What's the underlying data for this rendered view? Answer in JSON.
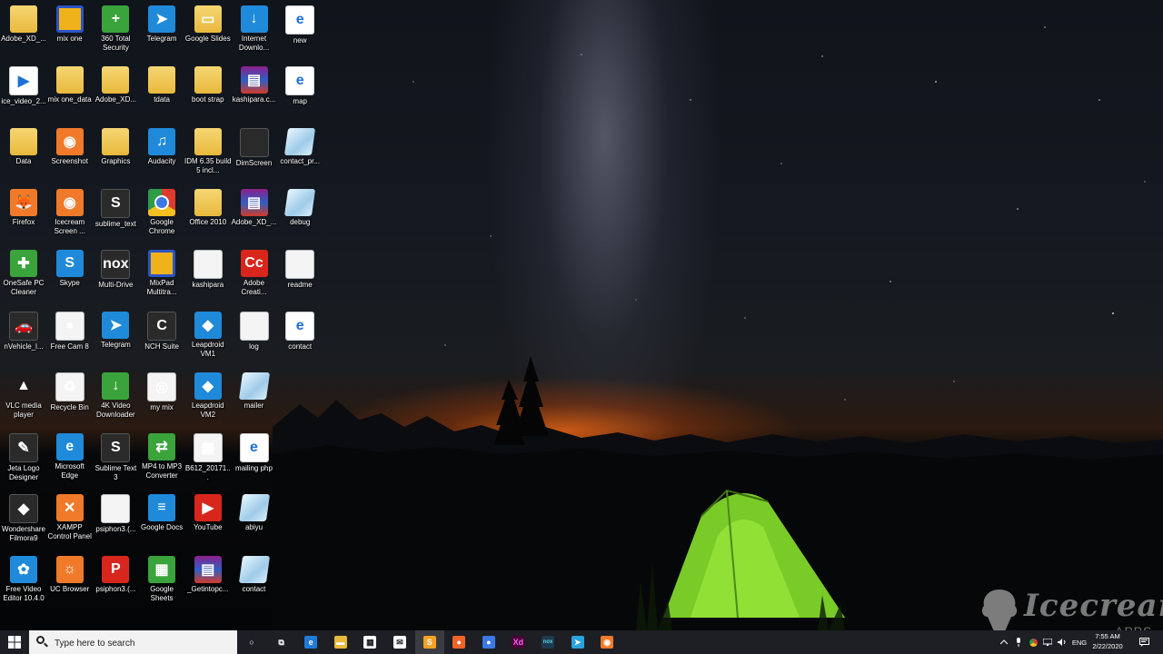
{
  "desktop": {
    "icons": [
      {
        "label": "Adobe_XD_...",
        "icon": "folder-icon"
      },
      {
        "label": "mix one",
        "icon": "mixpad-icon"
      },
      {
        "label": "360 Total Security",
        "icon": "360-security-icon"
      },
      {
        "label": "Telegram",
        "icon": "telegram-icon"
      },
      {
        "label": "Google Slides",
        "icon": "google-slides-icon"
      },
      {
        "label": "Internet Downlo...",
        "icon": "idm-icon"
      },
      {
        "label": "new",
        "icon": "ie-document-icon"
      },
      {
        "label": "ice_video_2...",
        "icon": "video-file-icon"
      },
      {
        "label": "mix one_data",
        "icon": "folder-icon"
      },
      {
        "label": "Adobe_XD...",
        "icon": "folder-icon"
      },
      {
        "label": "tdata",
        "icon": "folder-icon"
      },
      {
        "label": "boot strap",
        "icon": "folder-icon"
      },
      {
        "label": "kashipara.c...",
        "icon": "winrar-icon"
      },
      {
        "label": "map",
        "icon": "ie-document-icon"
      },
      {
        "label": "Data",
        "icon": "folder-icon"
      },
      {
        "label": "Screenshot",
        "icon": "icecream-screenshot-icon"
      },
      {
        "label": "Graphics",
        "icon": "folder-icon"
      },
      {
        "label": "Audacity",
        "icon": "audacity-icon"
      },
      {
        "label": "IDM 6.35 build 5 incl...",
        "icon": "folder-icon"
      },
      {
        "label": "DimScreen",
        "icon": "dimscreen-icon"
      },
      {
        "label": "contact_pr...",
        "icon": "glass-file-icon"
      },
      {
        "label": "Firefox",
        "icon": "firefox-icon"
      },
      {
        "label": "Icecream Screen ...",
        "icon": "icecream-recorder-icon"
      },
      {
        "label": "sublime_text",
        "icon": "sublime-icon"
      },
      {
        "label": "Google Chrome",
        "icon": "chrome-icon"
      },
      {
        "label": "Office 2010",
        "icon": "folder-icon"
      },
      {
        "label": "Adobe_XD_...",
        "icon": "winrar-icon"
      },
      {
        "label": "debug",
        "icon": "glass-file-icon"
      },
      {
        "label": "OneSafe PC Cleaner",
        "icon": "onesafe-icon"
      },
      {
        "label": "Skype",
        "icon": "skype-icon"
      },
      {
        "label": "Multi-Drive",
        "icon": "nox-icon"
      },
      {
        "label": "MixPad Multitra...",
        "icon": "mixpad-icon"
      },
      {
        "label": "kashipara",
        "icon": "document-icon"
      },
      {
        "label": "Adobe Creati...",
        "icon": "adobe-cc-icon"
      },
      {
        "label": "readme",
        "icon": "document-icon"
      },
      {
        "label": "nVehicle_l...",
        "icon": "vehicle-icon"
      },
      {
        "label": "Free Cam 8",
        "icon": "freecam-icon"
      },
      {
        "label": "Telegram",
        "icon": "telegram-icon"
      },
      {
        "label": "NCH Suite",
        "icon": "nch-icon"
      },
      {
        "label": "Leapdroid VM1",
        "icon": "leapdroid-icon"
      },
      {
        "label": "log",
        "icon": "document-icon"
      },
      {
        "label": "contact",
        "icon": "ie-document-icon"
      },
      {
        "label": "VLC media player",
        "icon": "vlc-icon"
      },
      {
        "label": "Recycle Bin",
        "icon": "recycle-bin-icon"
      },
      {
        "label": "4K Video Downloader",
        "icon": "4k-downloader-icon"
      },
      {
        "label": "my mix",
        "icon": "mixpad-file-icon"
      },
      {
        "label": "Leapdroid VM2",
        "icon": "leapdroid-icon"
      },
      {
        "label": "mailer",
        "icon": "glass-file-icon"
      },
      {
        "label": "",
        "icon": "none"
      },
      {
        "label": "Jeta Logo Designer",
        "icon": "jeta-icon"
      },
      {
        "label": "Microsoft Edge",
        "icon": "edge-icon"
      },
      {
        "label": "Sublime Text 3",
        "icon": "sublime-icon"
      },
      {
        "label": "MP4 to MP3 Converter",
        "icon": "converter-icon"
      },
      {
        "label": "B612_20171...",
        "icon": "photo-icon"
      },
      {
        "label": "mailing php",
        "icon": "ie-document-icon"
      },
      {
        "label": "",
        "icon": "none"
      },
      {
        "label": "Wondershare Filmora9",
        "icon": "filmora-icon"
      },
      {
        "label": "XAMPP Control Panel",
        "icon": "xampp-icon"
      },
      {
        "label": "psiphon3.(...",
        "icon": "document-icon"
      },
      {
        "label": "Google Docs",
        "icon": "google-docs-icon"
      },
      {
        "label": "YouTube",
        "icon": "youtube-icon"
      },
      {
        "label": "abiyu",
        "icon": "glass-file-icon"
      },
      {
        "label": "",
        "icon": "none"
      },
      {
        "label": "Free Video Editor 10.4.0",
        "icon": "video-editor-icon"
      },
      {
        "label": "UC Browser",
        "icon": "uc-browser-icon"
      },
      {
        "label": "psiphon3.(...",
        "icon": "psiphon-icon"
      },
      {
        "label": "Google Sheets",
        "icon": "google-sheets-icon"
      },
      {
        "label": "_Getintopc...",
        "icon": "winrar-icon"
      },
      {
        "label": "contact",
        "icon": "glass-file-icon"
      },
      {
        "label": "",
        "icon": "none"
      }
    ]
  },
  "taskbar": {
    "search_placeholder": "Type here to search",
    "pinned": [
      {
        "name": "cortana-icon"
      },
      {
        "name": "task-view-icon"
      },
      {
        "name": "edge-icon"
      },
      {
        "name": "file-explorer-icon"
      },
      {
        "name": "store-icon"
      },
      {
        "name": "mail-icon"
      },
      {
        "name": "sublime-icon",
        "active": true
      },
      {
        "name": "firefox-icon"
      },
      {
        "name": "chrome-icon"
      },
      {
        "name": "adobe-xd-icon",
        "text": "Xd"
      },
      {
        "name": "nox-icon",
        "text": "nox"
      },
      {
        "name": "telegram-icon"
      },
      {
        "name": "icecream-recorder-icon"
      }
    ],
    "tray": {
      "language": "ENG",
      "time": "7:55 AM",
      "date": "2/22/2020"
    }
  },
  "watermark": {
    "brand": "Icecream",
    "product": "APPS"
  },
  "colors": {
    "taskbar": "#1d1f24",
    "search_box": "#f2f2f2",
    "tent": "#7fd62a",
    "horizon_glow": "#ff6e14"
  }
}
